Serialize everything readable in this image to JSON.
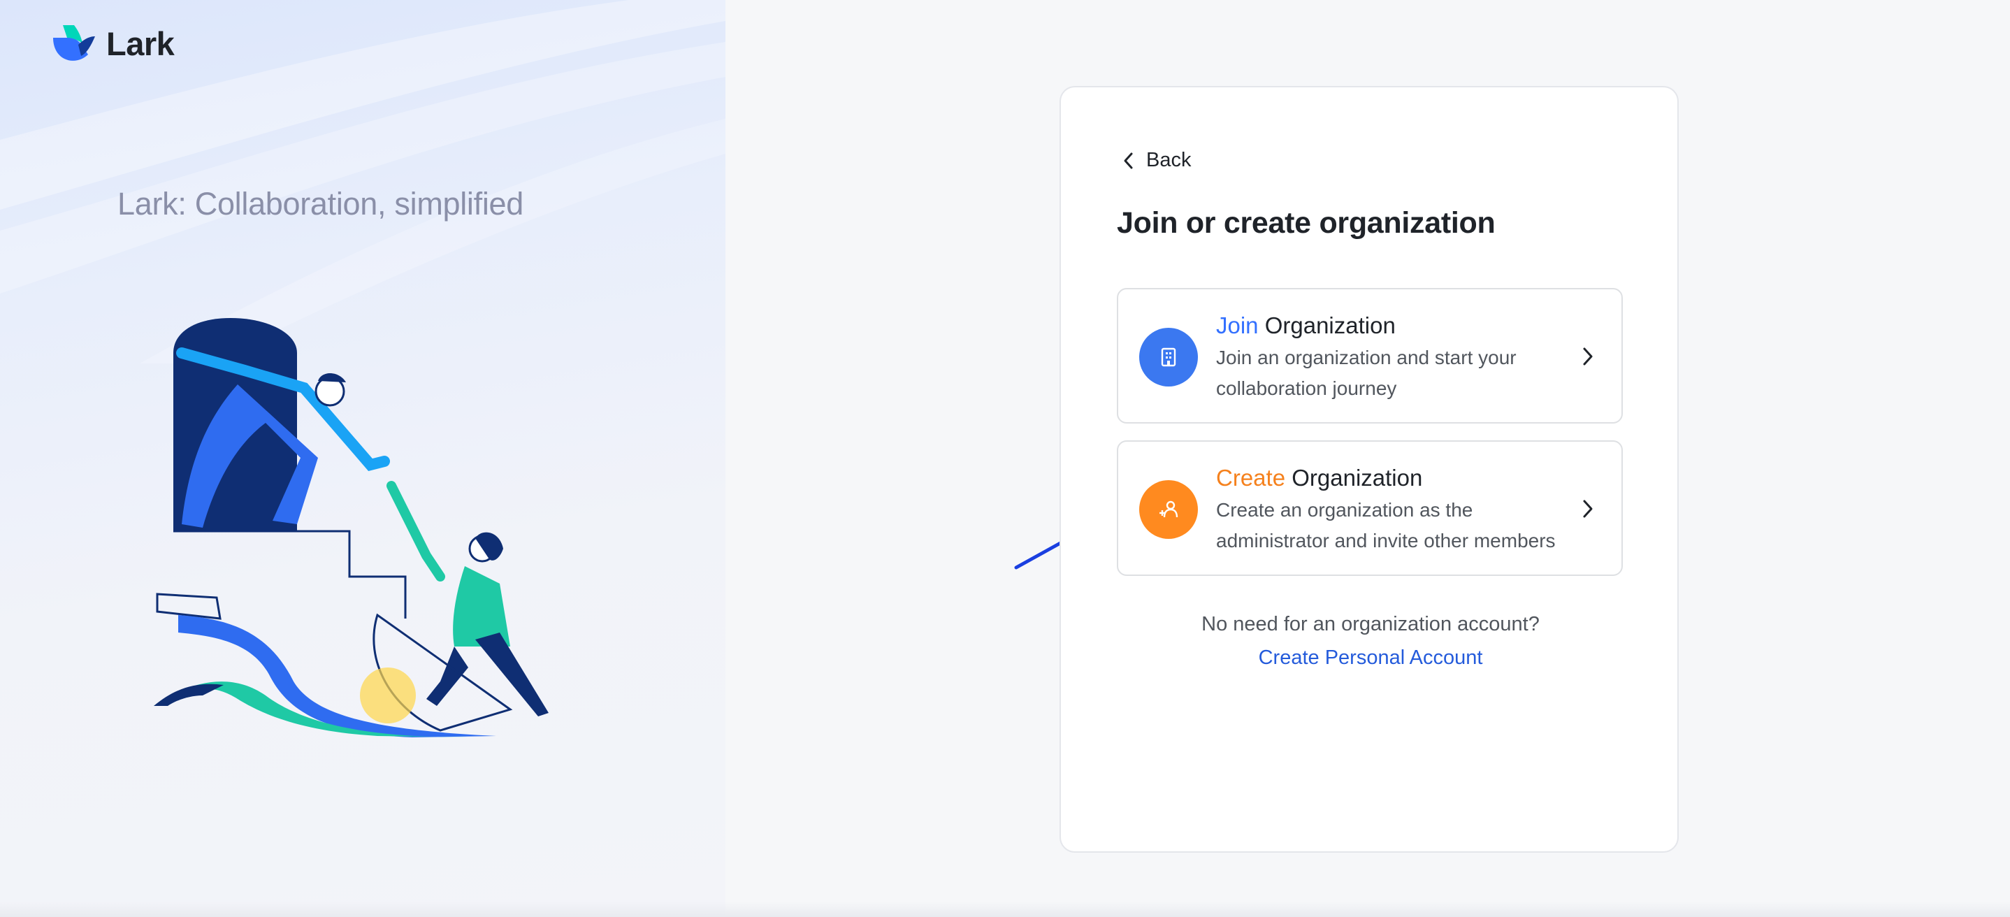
{
  "brand": {
    "name": "Lark",
    "logo_icon": "lark-logo-icon",
    "tagline": "Lark: Collaboration, simplified"
  },
  "colors": {
    "accent_blue": "#3370ff",
    "accent_orange": "#f5811d",
    "link_blue": "#245bdb",
    "join_icon_bg": "#3b78f0",
    "create_icon_bg": "#ff8a1f",
    "annotation_arrow": "#1a3fe0"
  },
  "card": {
    "back_label": "Back",
    "title": "Join or create organization",
    "options": [
      {
        "icon": "building-icon",
        "accent": "Join",
        "rest": " Organization",
        "desc_line1": "Join an organization and start your",
        "desc_line2": "collaboration journey"
      },
      {
        "icon": "add-people-icon",
        "accent": "Create",
        "rest": " Organization",
        "desc_line1": "Create an organization as the",
        "desc_line2": "administrator and invite other members"
      }
    ],
    "no_need_text": "No need for an organization account?",
    "personal_link": "Create Personal Account"
  }
}
